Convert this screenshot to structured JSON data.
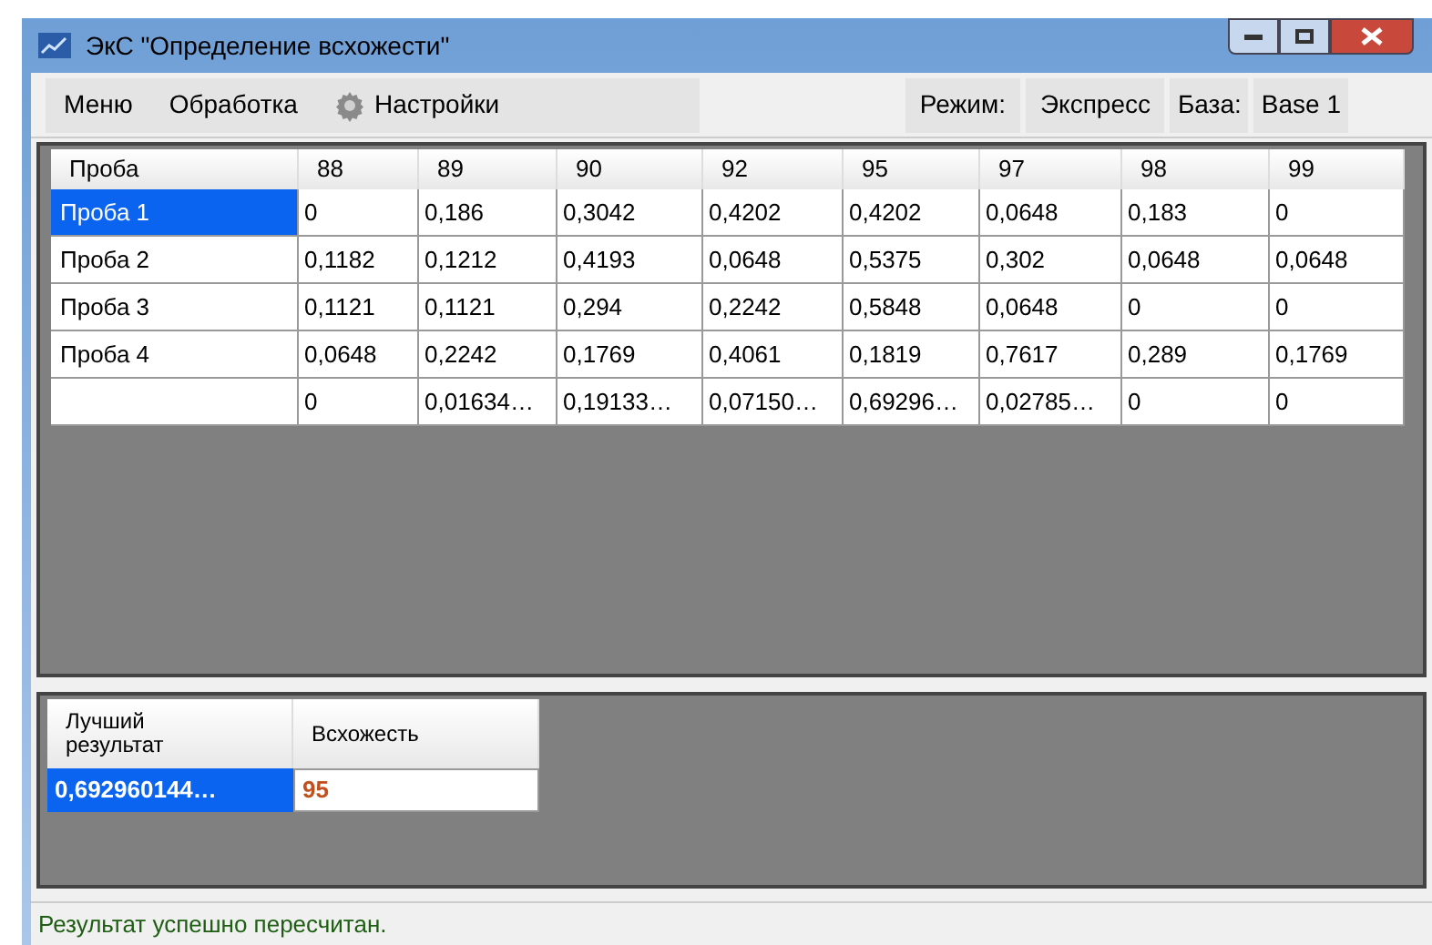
{
  "window": {
    "title": "ЭкС \"Определение всхожести\""
  },
  "menu": [
    {
      "label": "Меню",
      "kind": "plain"
    },
    {
      "label": "Обработка",
      "kind": "plain"
    },
    {
      "label": "Настройки",
      "kind": "settings"
    }
  ],
  "mode": {
    "label": "Режим:",
    "value": "Экспресс"
  },
  "base": {
    "label": "База:",
    "value": "Base 1"
  },
  "table": {
    "columns": [
      "Проба",
      "88",
      "89",
      "90",
      "92",
      "95",
      "97",
      "98",
      "99"
    ],
    "rows": [
      {
        "label": "Проба 1",
        "selected": true,
        "values": [
          "0",
          "0,186",
          "0,3042",
          "0,4202",
          "0,4202",
          "0,0648",
          "0,183",
          "0"
        ]
      },
      {
        "label": "Проба 2",
        "selected": false,
        "values": [
          "0,1182",
          "0,1212",
          "0,4193",
          "0,0648",
          "0,5375",
          "0,302",
          "0,0648",
          "0,0648"
        ]
      },
      {
        "label": "Проба 3",
        "selected": false,
        "values": [
          "0,1121",
          "0,1121",
          "0,294",
          "0,2242",
          "0,5848",
          "0,0648",
          "0",
          "0"
        ]
      },
      {
        "label": "Проба 4",
        "selected": false,
        "values": [
          "0,0648",
          "0,2242",
          "0,1769",
          "0,4061",
          "0,1819",
          "0,7617",
          "0,289",
          "0,1769"
        ]
      },
      {
        "label": "",
        "selected": false,
        "values": [
          "0",
          "0,01634…",
          "0,19133…",
          "0,07150…",
          "0,69296…",
          "0,02785…",
          "0",
          "0"
        ]
      }
    ]
  },
  "result": {
    "columns": [
      "Лучший результат",
      "Всхожесть"
    ],
    "best": "0,692960144…",
    "selected": true,
    "germination": "95"
  },
  "status_bar": "Результат успешно пересчитан."
}
